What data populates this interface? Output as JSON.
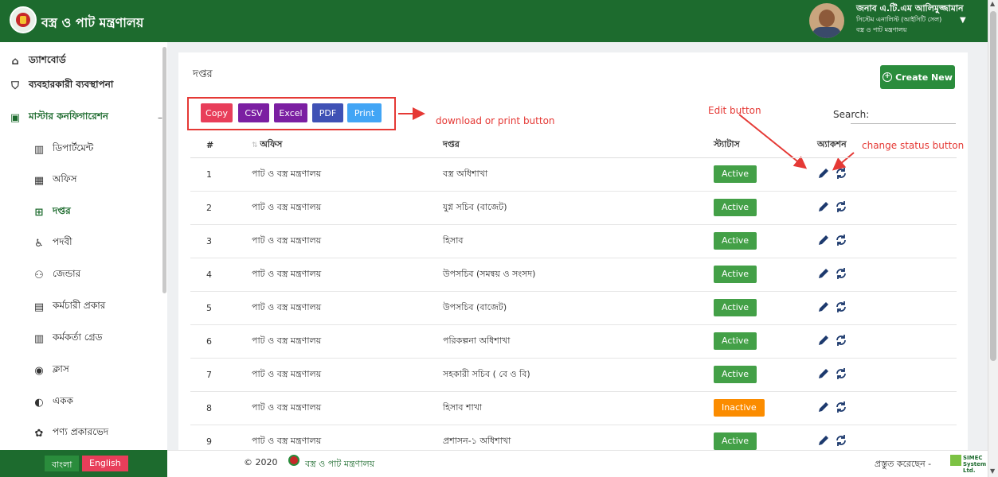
{
  "header": {
    "title": "বস্ত্র ও পাট মন্ত্রণালয়",
    "user": {
      "name": "জনাব এ.টি.এম আলিমুজ্জামান",
      "designation": "সিস্টেম এনালিস্ট (আইসিটি সেল)",
      "ministry": "বস্ত্র ও পাট মন্ত্রণালয়"
    }
  },
  "sidebar": {
    "items": [
      {
        "label": "ড্যাশবোর্ড",
        "icon": "home-icon"
      },
      {
        "label": "ব্যবহারকারী ব্যবস্থাপনা",
        "icon": "shield-icon"
      },
      {
        "label": "মাস্টার কনফিগারেশন",
        "icon": "monitor-icon",
        "collapse": "–"
      },
      {
        "label": "ডিপার্টমেন্ট",
        "icon": "bar-chart-icon"
      },
      {
        "label": "অফিস",
        "icon": "building-icon"
      },
      {
        "label": "দপ্তর",
        "icon": "table-icon"
      },
      {
        "label": "পদবী",
        "icon": "wheelchair-icon"
      },
      {
        "label": "জেন্ডার",
        "icon": "users-icon"
      },
      {
        "label": "কর্মচারী প্রকার",
        "icon": "id-badge-icon"
      },
      {
        "label": "কর্মকর্তা গ্রেড",
        "icon": "bar-chart-icon"
      },
      {
        "label": "ক্লাস",
        "icon": "user-circle-icon"
      },
      {
        "label": "একক",
        "icon": "half-circle-icon"
      },
      {
        "label": "পণ্য প্রকারভেদ",
        "icon": "palette-icon"
      }
    ]
  },
  "page": {
    "title": "দপ্তর",
    "create_button": "Create New",
    "export_buttons": [
      "Copy",
      "CSV",
      "Excel",
      "PDF",
      "Print"
    ],
    "search_label": "Search:",
    "annotations": {
      "download": "download or print button",
      "edit": "Edit button",
      "status": "change status button"
    },
    "table": {
      "headers": [
        "#",
        "অফিস",
        "দপ্তর",
        "স্ট্যাটাস",
        "অ্যাকশন"
      ],
      "rows": [
        {
          "n": "1",
          "office": "পাট ও বস্ত্র মন্ত্রণালয়",
          "dept": "বস্ত্র অধিশাখা",
          "status": "Active"
        },
        {
          "n": "2",
          "office": "পাট ও বস্ত্র মন্ত্রণালয়",
          "dept": "যুগ্ন সচিব (বাজেট)",
          "status": "Active"
        },
        {
          "n": "3",
          "office": "পাট ও বস্ত্র মন্ত্রণালয়",
          "dept": "হিসাব",
          "status": "Active"
        },
        {
          "n": "4",
          "office": "পাট ও বস্ত্র মন্ত্রণালয়",
          "dept": "উপসচিব (সমন্বয় ও সংসদ)",
          "status": "Active"
        },
        {
          "n": "5",
          "office": "পাট ও বস্ত্র মন্ত্রণালয়",
          "dept": "উপসচিব (বাজেট)",
          "status": "Active"
        },
        {
          "n": "6",
          "office": "পাট ও বস্ত্র মন্ত্রণালয়",
          "dept": "পরিকল্পনা অধিশাখা",
          "status": "Active"
        },
        {
          "n": "7",
          "office": "পাট ও বস্ত্র মন্ত্রণালয়",
          "dept": "সহকারী সচিব ( বে ও বি)",
          "status": "Active"
        },
        {
          "n": "8",
          "office": "পাট ও বস্ত্র মন্ত্রণালয়",
          "dept": "হিসাব শাখা",
          "status": "Inactive"
        },
        {
          "n": "9",
          "office": "পাট ও বস্ত্র মন্ত্রণালয়",
          "dept": "প্রশাসন-১ অধিশাখা",
          "status": "Active"
        }
      ]
    }
  },
  "footer": {
    "copyright": "© 2020",
    "ministry_link": "বস্ত্র ও পাট মন্ত্রণালয়",
    "made_by": "প্রস্তুত করেছেন -",
    "vendor": "SIMEC",
    "vendor_sub": "System Ltd.",
    "lang": {
      "bn": "বাংলা",
      "en": "English"
    }
  },
  "colors": {
    "brand": "#1d6b2e",
    "active": "#43a047",
    "inactive": "#fb8c00",
    "annotation": "#e53935"
  }
}
